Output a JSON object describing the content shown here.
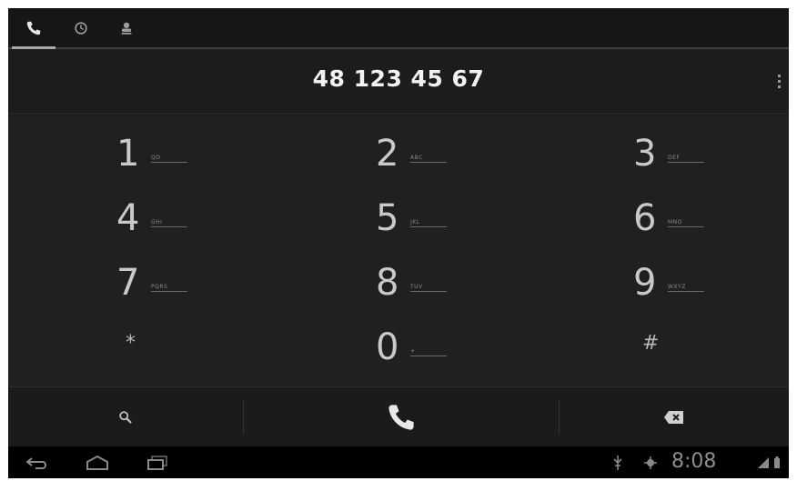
{
  "tabs": [
    {
      "id": "dialer",
      "icon": "phone-icon",
      "active": true
    },
    {
      "id": "call-log",
      "icon": "clock-icon",
      "active": false
    },
    {
      "id": "contacts",
      "icon": "contacts-icon",
      "active": false
    }
  ],
  "display": {
    "number": "48 123 45 67"
  },
  "keys": [
    {
      "digit": "1",
      "letters": "QO"
    },
    {
      "digit": "2",
      "letters": "ABC"
    },
    {
      "digit": "3",
      "letters": "DEF"
    },
    {
      "digit": "4",
      "letters": "GHI"
    },
    {
      "digit": "5",
      "letters": "JKL"
    },
    {
      "digit": "6",
      "letters": "MNO"
    },
    {
      "digit": "7",
      "letters": "PQRS"
    },
    {
      "digit": "8",
      "letters": "TUV"
    },
    {
      "digit": "9",
      "letters": "WXYZ"
    },
    {
      "digit": "*",
      "letters": ""
    },
    {
      "digit": "0",
      "letters": "+"
    },
    {
      "digit": "#",
      "letters": ""
    }
  ],
  "actions": {
    "search": "search-icon",
    "call": "call-icon",
    "delete": "backspace-icon"
  },
  "statusbar": {
    "time": "8:08"
  },
  "colors": {
    "background": "#151515",
    "keypad": "#202020",
    "text": "#f2f2f2",
    "accent": "#a9a9a9"
  }
}
